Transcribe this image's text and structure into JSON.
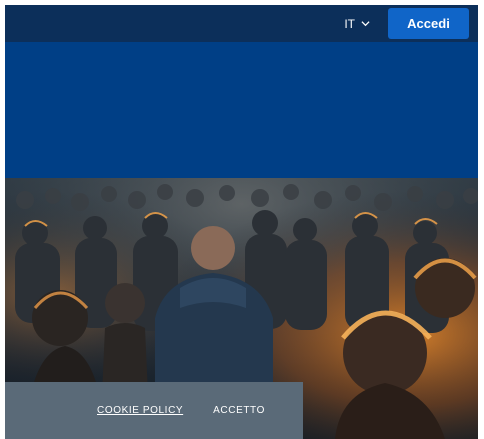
{
  "header": {
    "language": "IT",
    "login_label": "Accedi"
  },
  "hero": {
    "image_icon": "crowd-photo"
  },
  "cookie_banner": {
    "policy_label": "COOKIE POLICY",
    "accept_label": "ACCETTO"
  },
  "colors": {
    "topbar": "#0c2f5a",
    "hero_blue": "#003f86",
    "button": "#1065c8",
    "cookie_bar": "#5a6a78"
  }
}
